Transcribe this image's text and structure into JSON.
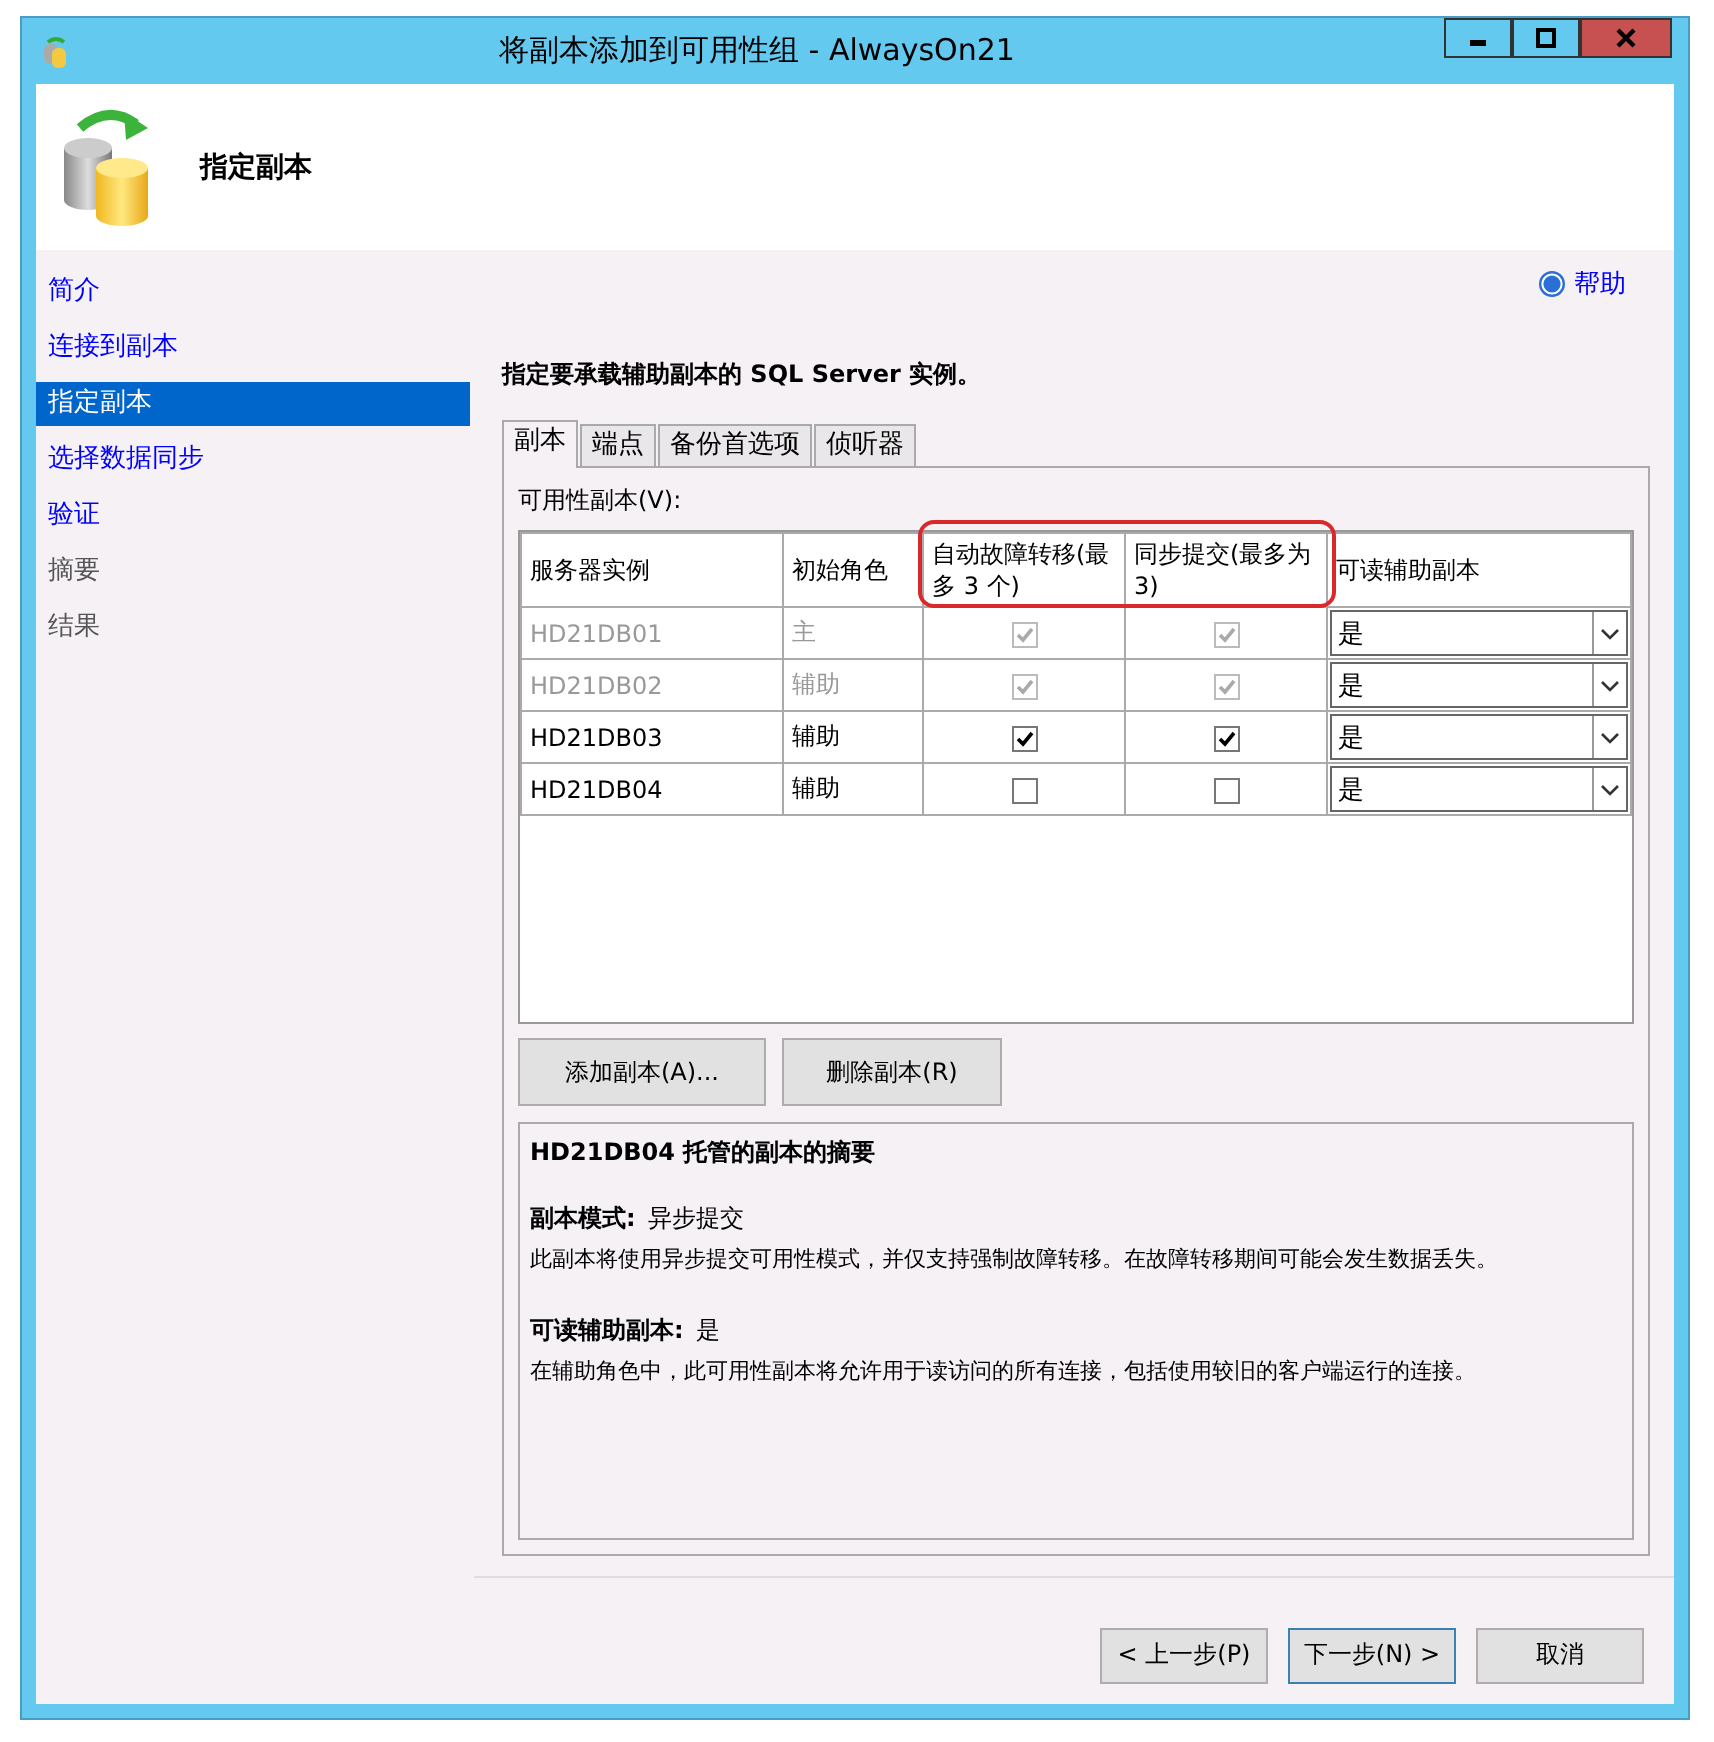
{
  "window": {
    "title": "将副本添加到可用性组 - AlwaysOn21"
  },
  "header": {
    "title": "指定副本"
  },
  "sidebar": {
    "items": [
      {
        "label": "简介",
        "selected": false,
        "enabled": true
      },
      {
        "label": "连接到副本",
        "selected": false,
        "enabled": true
      },
      {
        "label": "指定副本",
        "selected": true,
        "enabled": true
      },
      {
        "label": "选择数据同步",
        "selected": false,
        "enabled": true
      },
      {
        "label": "验证",
        "selected": false,
        "enabled": true
      },
      {
        "label": "摘要",
        "selected": false,
        "enabled": false
      },
      {
        "label": "结果",
        "selected": false,
        "enabled": false
      }
    ]
  },
  "help": {
    "label": "帮助"
  },
  "instruction": "指定要承载辅助副本的 SQL Server 实例。",
  "tabs": [
    {
      "label": "副本",
      "selected": true
    },
    {
      "label": "端点",
      "selected": false
    },
    {
      "label": "备份首选项",
      "selected": false
    },
    {
      "label": "侦听器",
      "selected": false
    }
  ],
  "table": {
    "label": "可用性副本(V):",
    "columns": [
      "服务器实例",
      "初始角色",
      "自动故障转移(最多 3 个)",
      "同步提交(最多为 3)",
      "可读辅助副本"
    ],
    "rows": [
      {
        "instance": "HD21DB01",
        "role": "主",
        "auto_failover": true,
        "sync_commit": true,
        "readable": "是",
        "disabled": true
      },
      {
        "instance": "HD21DB02",
        "role": "辅助",
        "auto_failover": true,
        "sync_commit": true,
        "readable": "是",
        "disabled": true
      },
      {
        "instance": "HD21DB03",
        "role": "辅助",
        "auto_failover": true,
        "sync_commit": true,
        "readable": "是",
        "disabled": false
      },
      {
        "instance": "HD21DB04",
        "role": "辅助",
        "auto_failover": false,
        "sync_commit": false,
        "readable": "是",
        "disabled": false
      }
    ]
  },
  "table_buttons": [
    "添加副本(A)...",
    "删除副本(R)"
  ],
  "summary": {
    "title": "HD21DB04 托管的副本的摘要",
    "sections": [
      {
        "label": "副本模式:",
        "value": "异步提交",
        "description": "此副本将使用异步提交可用性模式，并仅支持强制故障转移。在故障转移期间可能会发生数据丢失。"
      },
      {
        "label": "可读辅助副本:",
        "value": "是",
        "description": "在辅助角色中，此可用性副本将允许用于读访问的所有连接，包括使用较旧的客户端运行的连接。"
      }
    ]
  },
  "footer_buttons": [
    "< 上一步(P)",
    "下一步(N) >",
    "取消"
  ]
}
